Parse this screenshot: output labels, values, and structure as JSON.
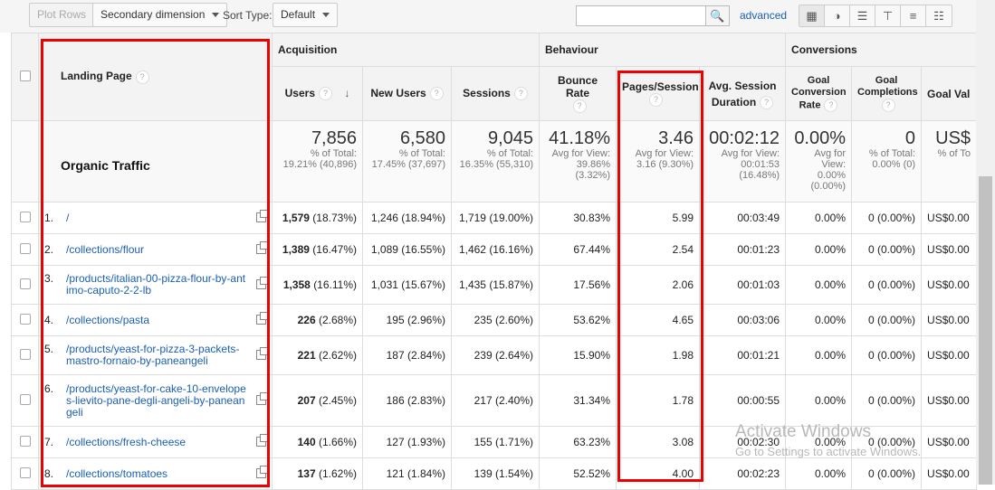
{
  "toolbar": {
    "plot_rows": "Plot Rows",
    "secondary_dimension": "Secondary dimension",
    "sort_type_label": "Sort Type:",
    "sort_type_value": "Default",
    "search_value": "",
    "advanced": "advanced",
    "views": [
      "grid-view-icon",
      "pie-view-icon",
      "bar-view-icon",
      "comparison-view-icon",
      "term-cloud-icon",
      "pivot-view-icon"
    ]
  },
  "groups": {
    "acquisition": "Acquisition",
    "behaviour": "Behaviour",
    "conversions": "Conversions"
  },
  "columns": {
    "landing_page": "Landing Page",
    "users": "Users",
    "new_users": "New Users",
    "sessions": "Sessions",
    "bounce_rate": "Bounce Rate",
    "pages_session": "Pages/Session",
    "avg_session_1": "Avg. Session",
    "avg_session_2": "Duration",
    "goal_conv_1": "Goal",
    "goal_conv_2": "Conversion",
    "goal_conv_3": "Rate",
    "goal_comp_1": "Goal",
    "goal_comp_2": "Completions",
    "goal_value": "Goal Val"
  },
  "totals": {
    "label": "Organic Traffic",
    "users": {
      "value": "7,856",
      "l1": "% of Total:",
      "l2": "19.21% (40,896)"
    },
    "new_users": {
      "value": "6,580",
      "l1": "% of Total:",
      "l2": "17.45% (37,697)"
    },
    "sessions": {
      "value": "9,045",
      "l1": "% of Total:",
      "l2": "16.35% (55,310)"
    },
    "bounce_rate": {
      "value": "41.18%",
      "l1": "Avg for View:",
      "l2": "39.86%",
      "l3": "(3.32%)"
    },
    "pages_session": {
      "value": "3.46",
      "l1": "Avg for View:",
      "l2": "3.16 (9.30%)"
    },
    "avg_session": {
      "value": "00:02:12",
      "l1": "Avg for View:",
      "l2": "00:01:53",
      "l3": "(16.48%)"
    },
    "goal_conv": {
      "value": "0.00%",
      "l1": "Avg for",
      "l2": "View:",
      "l3": "0.00%",
      "l4": "(0.00%)"
    },
    "goal_comp": {
      "value": "0",
      "l1": "% of Total:",
      "l2": "0.00% (0)"
    },
    "goal_value": {
      "value": "US$",
      "l1": "% of To"
    }
  },
  "rows": [
    {
      "idx": "1.",
      "page": "/",
      "users": "1,579",
      "users_pct": "(18.73%)",
      "new_users": "1,246",
      "new_users_pct": "(18.94%)",
      "sessions": "1,719",
      "sessions_pct": "(19.00%)",
      "bounce": "30.83%",
      "pps": "5.99",
      "dur": "00:03:49",
      "gcr": "0.00%",
      "gc": "0",
      "gc_pct": "(0.00%)",
      "gv": "US$0.00"
    },
    {
      "idx": "2.",
      "page": "/collections/flour",
      "users": "1,389",
      "users_pct": "(16.47%)",
      "new_users": "1,089",
      "new_users_pct": "(16.55%)",
      "sessions": "1,462",
      "sessions_pct": "(16.16%)",
      "bounce": "67.44%",
      "pps": "2.54",
      "dur": "00:01:23",
      "gcr": "0.00%",
      "gc": "0",
      "gc_pct": "(0.00%)",
      "gv": "US$0.00"
    },
    {
      "idx": "3.",
      "page": "/products/italian-00-pizza-flour-by-antimo-caputo-2-2-lb",
      "users": "1,358",
      "users_pct": "(16.11%)",
      "new_users": "1,031",
      "new_users_pct": "(15.67%)",
      "sessions": "1,435",
      "sessions_pct": "(15.87%)",
      "bounce": "17.56%",
      "pps": "2.06",
      "dur": "00:01:03",
      "gcr": "0.00%",
      "gc": "0",
      "gc_pct": "(0.00%)",
      "gv": "US$0.00"
    },
    {
      "idx": "4.",
      "page": "/collections/pasta",
      "users": "226",
      "users_pct": "(2.68%)",
      "new_users": "195",
      "new_users_pct": "(2.96%)",
      "sessions": "235",
      "sessions_pct": "(2.60%)",
      "bounce": "53.62%",
      "pps": "4.65",
      "dur": "00:03:06",
      "gcr": "0.00%",
      "gc": "0",
      "gc_pct": "(0.00%)",
      "gv": "US$0.00"
    },
    {
      "idx": "5.",
      "page": "/products/yeast-for-pizza-3-packets-mastro-fornaio-by-paneangeli",
      "users": "221",
      "users_pct": "(2.62%)",
      "new_users": "187",
      "new_users_pct": "(2.84%)",
      "sessions": "239",
      "sessions_pct": "(2.64%)",
      "bounce": "15.90%",
      "pps": "1.98",
      "dur": "00:01:21",
      "gcr": "0.00%",
      "gc": "0",
      "gc_pct": "(0.00%)",
      "gv": "US$0.00"
    },
    {
      "idx": "6.",
      "page": "/products/yeast-for-cake-10-envelopes-lievito-pane-degli-angeli-by-paneangeli",
      "users": "207",
      "users_pct": "(2.45%)",
      "new_users": "186",
      "new_users_pct": "(2.83%)",
      "sessions": "217",
      "sessions_pct": "(2.40%)",
      "bounce": "31.34%",
      "pps": "1.78",
      "dur": "00:00:55",
      "gcr": "0.00%",
      "gc": "0",
      "gc_pct": "(0.00%)",
      "gv": "US$0.00"
    },
    {
      "idx": "7.",
      "page": "/collections/fresh-cheese",
      "users": "140",
      "users_pct": "(1.66%)",
      "new_users": "127",
      "new_users_pct": "(1.93%)",
      "sessions": "155",
      "sessions_pct": "(1.71%)",
      "bounce": "63.23%",
      "pps": "3.08",
      "dur": "00:02:30",
      "gcr": "0.00%",
      "gc": "0",
      "gc_pct": "(0.00%)",
      "gv": "US$0.00"
    },
    {
      "idx": "8.",
      "page": "/collections/tomatoes",
      "users": "137",
      "users_pct": "(1.62%)",
      "new_users": "121",
      "new_users_pct": "(1.84%)",
      "sessions": "139",
      "sessions_pct": "(1.54%)",
      "bounce": "52.52%",
      "pps": "4.00",
      "dur": "00:02:23",
      "gcr": "0.00%",
      "gc": "0",
      "gc_pct": "(0.00%)",
      "gv": "US$0.00"
    }
  ],
  "watermark": {
    "line1": "Activate Windows",
    "line2": "Go to Settings to activate Windows."
  },
  "colors": {
    "highlight": "#e00000",
    "link": "#1a5fb4"
  }
}
